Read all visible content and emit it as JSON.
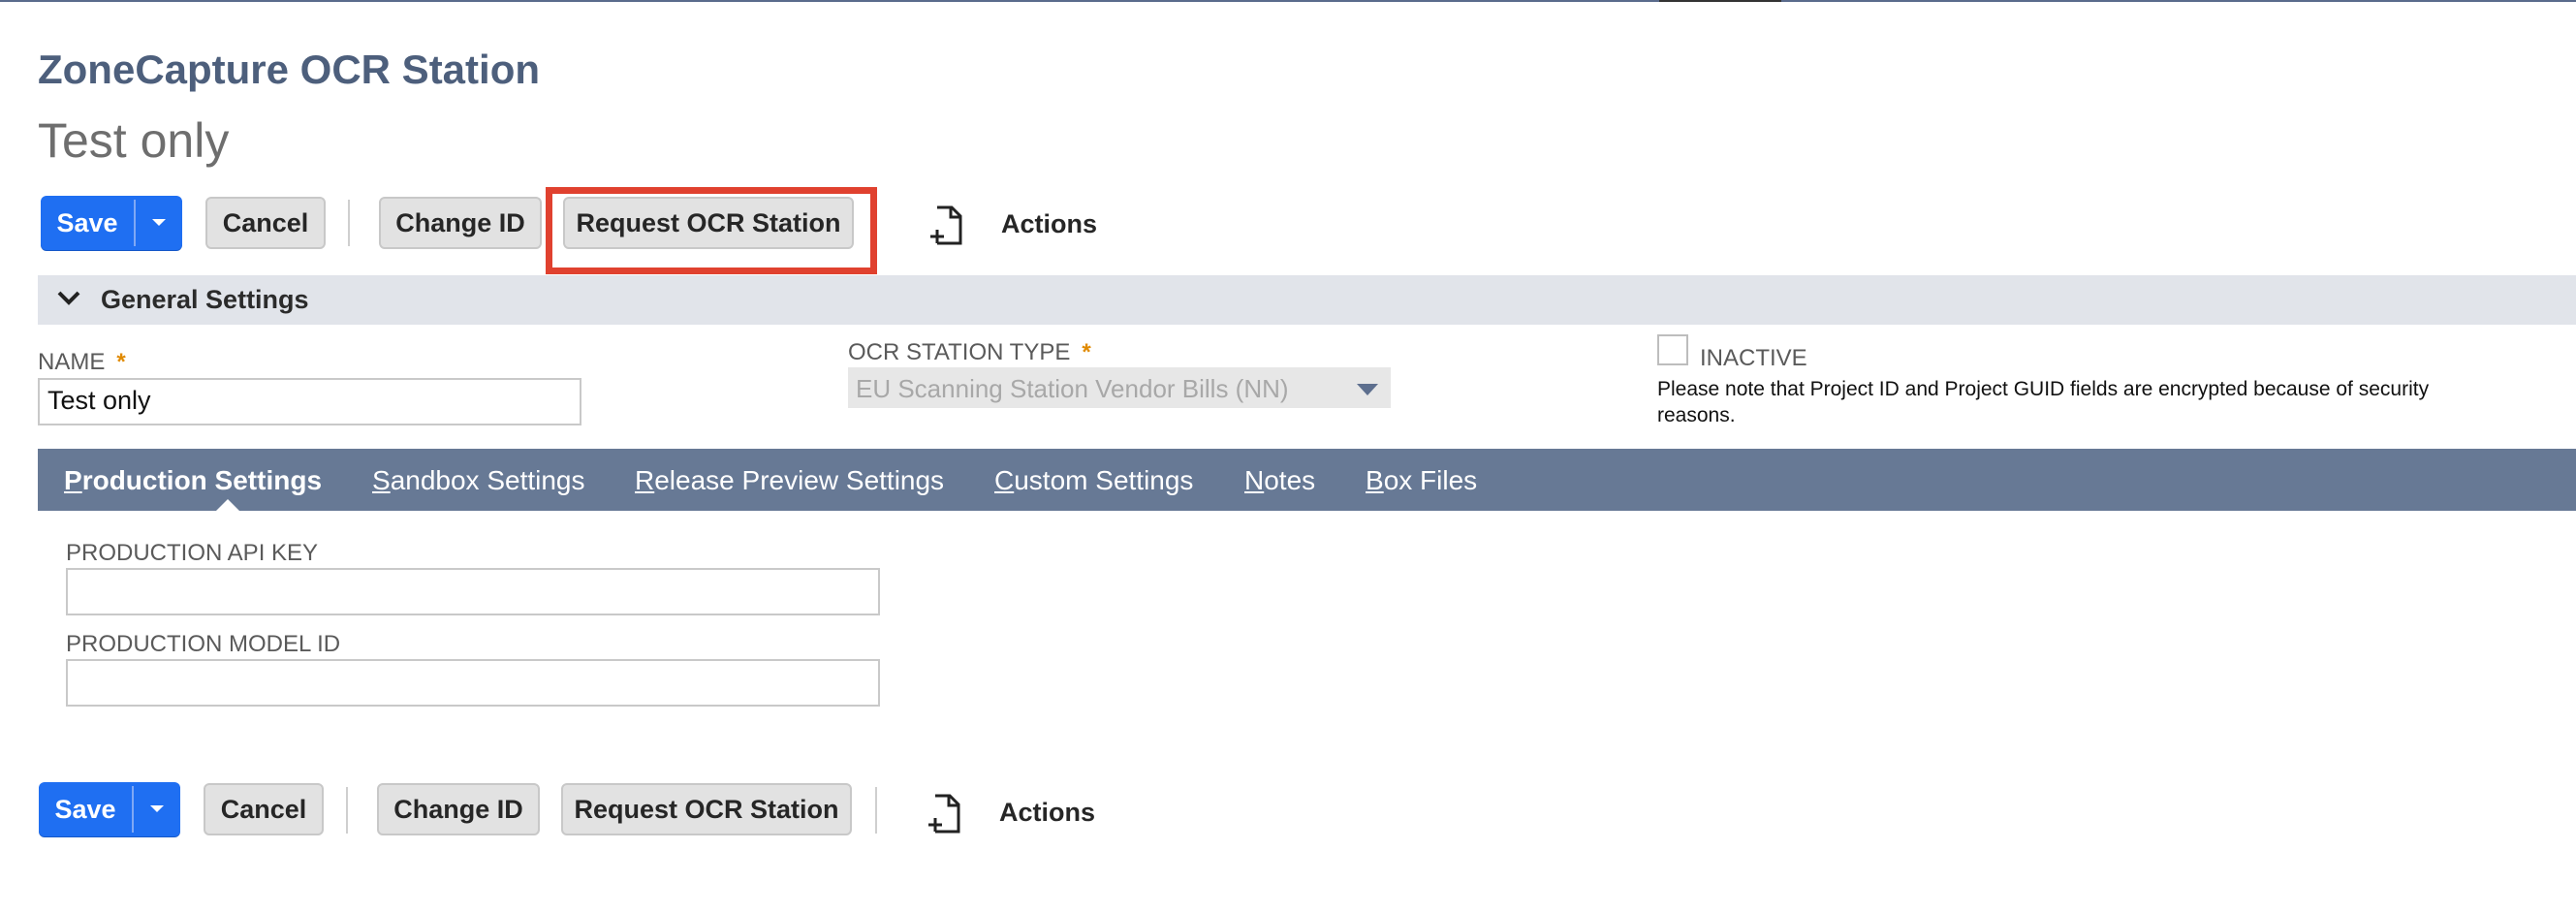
{
  "header": {
    "page_title": "ZoneCapture OCR Station",
    "record_name": "Test only"
  },
  "toolbar": {
    "save_label": "Save",
    "cancel_label": "Cancel",
    "change_id_label": "Change ID",
    "request_ocr_label": "Request OCR Station",
    "actions_label": "Actions"
  },
  "general_settings": {
    "section_title": "General Settings",
    "name_label": "NAME",
    "name_value": "Test only",
    "station_type_label": "OCR STATION TYPE",
    "station_type_value": "EU Scanning Station Vendor Bills (NN)",
    "inactive_label": "INACTIVE",
    "inactive_checked": false,
    "encryption_note": "Please note that Project ID and Project GUID fields are encrypted because of security reasons.",
    "required_marker": "*"
  },
  "tabs": [
    {
      "first": "P",
      "rest": "roduction Settings",
      "active": true
    },
    {
      "first": "S",
      "rest": "andbox Settings",
      "active": false
    },
    {
      "first": "R",
      "rest": "elease Preview Settings",
      "active": false
    },
    {
      "first": "C",
      "rest": "ustom Settings",
      "active": false
    },
    {
      "first": "N",
      "rest": "otes",
      "active": false
    },
    {
      "first": "B",
      "rest": "ox Files",
      "active": false
    }
  ],
  "production_settings": {
    "api_key_label": "PRODUCTION API KEY",
    "api_key_value": "",
    "model_id_label": "PRODUCTION MODEL ID",
    "model_id_value": ""
  },
  "colors": {
    "accent_blue": "#1f6ff2",
    "highlight_red": "#e0412f",
    "tab_bar": "#677995",
    "title_blue_grey": "#4d5f7c"
  }
}
